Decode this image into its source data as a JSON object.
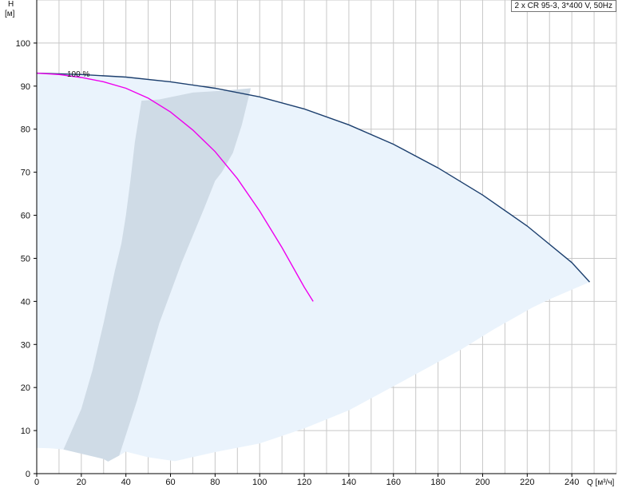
{
  "chart_data": {
    "type": "line",
    "title": "2 x CR 95-3, 3*400 V, 50Hz",
    "xlabel": "Q [м³/ч]",
    "ylabel_top": "H",
    "ylabel_unit": "[м]",
    "xlim": [
      0,
      260
    ],
    "ylim": [
      0,
      110
    ],
    "x_ticks": [
      0,
      20,
      40,
      60,
      80,
      100,
      120,
      140,
      160,
      180,
      200,
      220,
      240
    ],
    "y_ticks": [
      0,
      10,
      20,
      30,
      40,
      50,
      60,
      70,
      80,
      90,
      100
    ],
    "grid": true,
    "colors": {
      "region_light": "#eaf3fc",
      "region_dark": "#cfdbe6",
      "max_curve": "#1c3f6e",
      "duty_curve": "#ee00ee",
      "grid": "#c8c8c8",
      "axis": "#000000"
    },
    "series": [
      {
        "name": "100 %",
        "values": [
          [
            0,
            93
          ],
          [
            10,
            92.7
          ],
          [
            20,
            92
          ],
          [
            30,
            91
          ],
          [
            40,
            89.5
          ],
          [
            50,
            87.2
          ],
          [
            60,
            84
          ],
          [
            70,
            79.8
          ],
          [
            80,
            74.8
          ],
          [
            90,
            68.5
          ],
          [
            100,
            61
          ],
          [
            110,
            52.5
          ],
          [
            120,
            43.3
          ],
          [
            124,
            40
          ]
        ]
      },
      {
        "values": [
          [
            0,
            93
          ],
          [
            20,
            92.7
          ],
          [
            40,
            92.1
          ],
          [
            60,
            91
          ],
          [
            80,
            89.5
          ],
          [
            100,
            87.5
          ],
          [
            120,
            84.7
          ],
          [
            140,
            81
          ],
          [
            160,
            76.5
          ],
          [
            180,
            71
          ],
          [
            200,
            64.7
          ],
          [
            220,
            57.5
          ],
          [
            240,
            49
          ],
          [
            248,
            44.5
          ]
        ]
      }
    ],
    "regions": [
      {
        "polygon": [
          [
            0,
            93
          ],
          [
            20,
            92.7
          ],
          [
            40,
            92.1
          ],
          [
            60,
            91
          ],
          [
            80,
            89.5
          ],
          [
            100,
            87.5
          ],
          [
            120,
            84.7
          ],
          [
            140,
            81
          ],
          [
            160,
            76.5
          ],
          [
            180,
            71
          ],
          [
            200,
            64.7
          ],
          [
            220,
            57.5
          ],
          [
            240,
            49
          ],
          [
            248,
            44.5
          ],
          [
            230,
            40.5
          ],
          [
            222,
            38.5
          ],
          [
            205,
            33.5
          ],
          [
            190,
            28.7
          ],
          [
            175,
            24.5
          ],
          [
            160,
            20.3
          ],
          [
            140,
            14.7
          ],
          [
            120,
            10.5
          ],
          [
            100,
            7
          ],
          [
            80,
            5
          ],
          [
            62,
            2.9
          ],
          [
            50,
            3.8
          ],
          [
            40,
            5.1
          ],
          [
            37,
            4.2
          ],
          [
            32,
            2.8
          ],
          [
            30,
            3.4
          ],
          [
            12,
            5.6
          ],
          [
            6,
            5.9
          ],
          [
            0,
            6
          ]
        ]
      },
      {
        "polygon": [
          [
            12,
            5.6
          ],
          [
            20,
            15
          ],
          [
            25,
            24
          ],
          [
            30,
            35
          ],
          [
            35,
            47
          ],
          [
            38,
            53.5
          ],
          [
            40,
            60
          ],
          [
            42,
            68
          ],
          [
            44,
            77
          ],
          [
            47,
            86.6
          ],
          [
            55,
            86.9
          ],
          [
            70,
            88.5
          ],
          [
            85,
            89
          ],
          [
            96,
            89.5
          ],
          [
            92,
            81
          ],
          [
            88,
            74.5
          ],
          [
            83,
            70
          ],
          [
            80,
            68
          ],
          [
            75,
            61.5
          ],
          [
            65,
            49
          ],
          [
            55,
            35
          ],
          [
            50,
            26
          ],
          [
            45,
            17
          ],
          [
            40,
            9
          ],
          [
            37,
            4.2
          ],
          [
            32,
            2.8
          ],
          [
            30,
            3.4
          ]
        ]
      }
    ]
  }
}
